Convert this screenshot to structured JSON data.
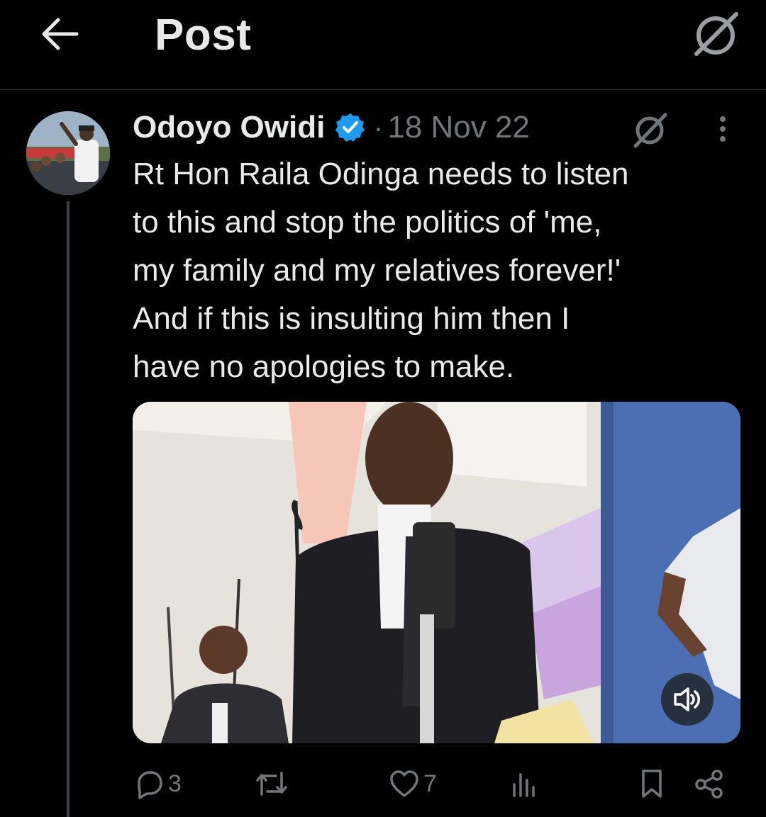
{
  "header": {
    "title": "Post"
  },
  "post": {
    "author_name": "Odoyo Owidi",
    "separator": "·",
    "date": "18 Nov 22",
    "text": "Rt Hon Raila Odinga needs to listen\nto this and stop the politics of 'me,\nmy family and my relatives forever!'\nAnd if this is insulting him then I\nhave no apologies to make."
  },
  "actions": {
    "reply_count": "3",
    "repost_count": "",
    "like_count": "7",
    "views_count": ""
  },
  "icons": {
    "back": "arrow-left-icon",
    "grok": "grok-icon",
    "verified": "verified-badge-icon",
    "more": "more-vertical-icon",
    "mute": "speaker-icon",
    "reply": "reply-icon",
    "repost": "repost-icon",
    "like": "heart-icon",
    "views": "views-icon",
    "bookmark": "bookmark-icon",
    "share": "share-icon"
  },
  "colors": {
    "background": "#000000",
    "text": "#e7e9ea",
    "muted": "#71767b",
    "verified": "#1d9bf0"
  }
}
